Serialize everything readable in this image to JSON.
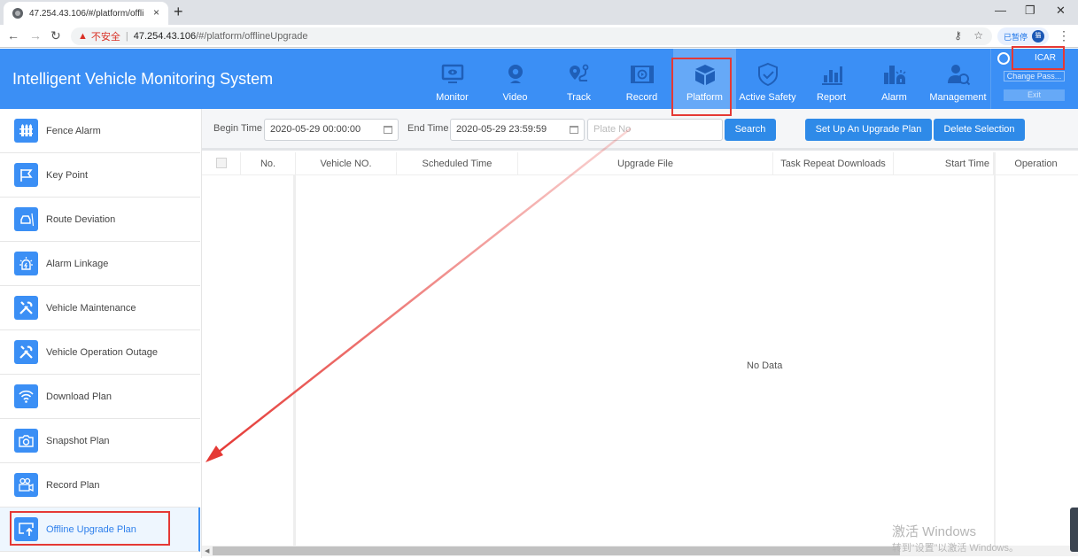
{
  "browser": {
    "tab_title": "47.254.43.106/#/platform/offli",
    "tab_close": "×",
    "new_tab": "+",
    "security_label": "不安全",
    "url_host": "47.254.43.106",
    "url_path": "/#/platform/offlineUpgrade",
    "profile_status": "已暂停",
    "profile_initial": "猫"
  },
  "app": {
    "title": "Intelligent Vehicle Monitoring System",
    "nav": [
      {
        "label": "Monitor",
        "icon": "monitor-icon"
      },
      {
        "label": "Video",
        "icon": "webcam-icon"
      },
      {
        "label": "Track",
        "icon": "track-icon"
      },
      {
        "label": "Record",
        "icon": "film-icon"
      },
      {
        "label": "Platform",
        "icon": "cube-icon",
        "active": true
      },
      {
        "label": "Active Safety",
        "icon": "shield-icon"
      },
      {
        "label": "Report",
        "icon": "bar-chart-icon"
      },
      {
        "label": "Alarm",
        "icon": "alarm-building-icon"
      },
      {
        "label": "Management",
        "icon": "user-gear-icon"
      }
    ],
    "user": {
      "name": "ICAR",
      "change_password": "Change Pass...",
      "exit": "Exit"
    }
  },
  "sidebar": {
    "items": [
      {
        "label": "Fence Alarm",
        "icon": "fence-icon"
      },
      {
        "label": "Key Point",
        "icon": "flag-icon"
      },
      {
        "label": "Route Deviation",
        "icon": "car-road-icon"
      },
      {
        "label": "Alarm Linkage",
        "icon": "siren-icon"
      },
      {
        "label": "Vehicle Maintenance",
        "icon": "tools-icon"
      },
      {
        "label": "Vehicle Operation Outage",
        "icon": "tools-icon"
      },
      {
        "label": "Download Plan",
        "icon": "wifi-icon"
      },
      {
        "label": "Snapshot Plan",
        "icon": "camera-icon"
      },
      {
        "label": "Record Plan",
        "icon": "video-camera-icon"
      },
      {
        "label": "Offline Upgrade Plan",
        "icon": "upload-screen-icon",
        "active": true
      }
    ]
  },
  "filters": {
    "begin_label": "Begin Time",
    "begin_value": "2020-05-29 00:00:00",
    "end_label": "End Time",
    "end_value": "2020-05-29 23:59:59",
    "plate_placeholder": "Plate No",
    "search": "Search",
    "setup_plan": "Set Up An Upgrade Plan",
    "delete_selection": "Delete Selection"
  },
  "table": {
    "columns": [
      "No.",
      "Vehicle NO.",
      "Scheduled Time",
      "Upgrade File",
      "Task Repeat Downloads",
      "Start Time",
      "Operation"
    ],
    "empty_text": "No Data"
  },
  "watermark": {
    "line1": "激活 Windows",
    "line2": "转到“设置”以激活 Windows。"
  },
  "colors": {
    "header_blue": "#3b8ff5",
    "active_nav": "#66a9f7",
    "button_blue": "#2e8ae8",
    "annotation_red": "#e53935"
  }
}
